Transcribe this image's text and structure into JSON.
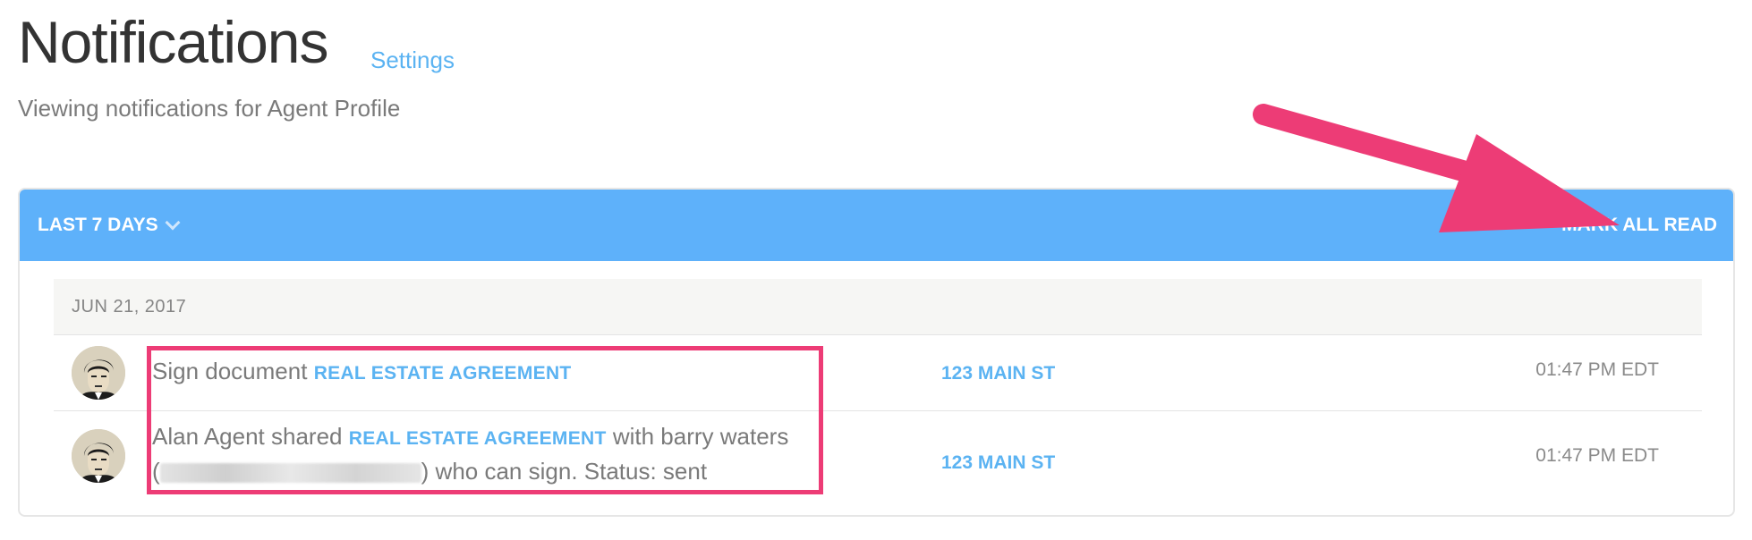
{
  "header": {
    "title": "Notifications",
    "settings_label": "Settings",
    "subtitle": "Viewing notifications for Agent Profile"
  },
  "panel": {
    "period_label": "LAST 7 DAYS",
    "mark_all_read_label": "MARK ALL READ",
    "accent_color": "#5eb1fa"
  },
  "groups": [
    {
      "date": "JUN 21, 2017",
      "notifications": [
        {
          "action": "Sign document",
          "document": "REAL ESTATE AGREEMENT",
          "property": "123 MAIN ST",
          "time": "01:47 PM EDT"
        },
        {
          "actor_text": "Alan Agent shared",
          "document": "REAL ESTATE AGREEMENT",
          "recipient_text": "with barry waters",
          "suffix_text": ") who can sign. Status: sent",
          "property": "123 MAIN ST",
          "time": "01:47 PM EDT"
        }
      ]
    }
  ],
  "annotation": {
    "highlight_color": "#ed3c76"
  }
}
